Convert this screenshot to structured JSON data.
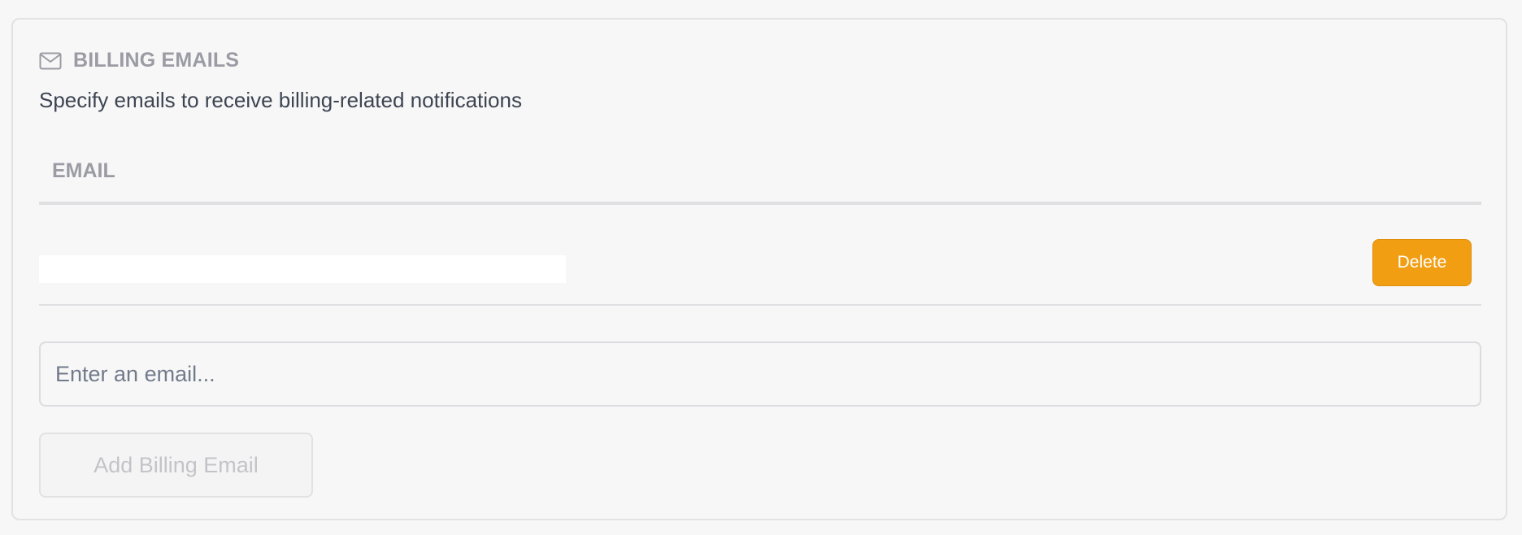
{
  "section": {
    "icon": "mail-icon",
    "title": "BILLING EMAILS",
    "description": "Specify emails to receive billing-related notifications"
  },
  "table": {
    "columns": [
      "EMAIL"
    ],
    "rows": [
      {
        "email": "",
        "delete_label": "Delete"
      }
    ]
  },
  "form": {
    "input_value": "",
    "input_placeholder": "Enter an email...",
    "add_label": "Add Billing Email"
  },
  "colors": {
    "accent": "#f29e13",
    "muted_text": "#9b9ba4",
    "body_text": "#3d4452"
  }
}
